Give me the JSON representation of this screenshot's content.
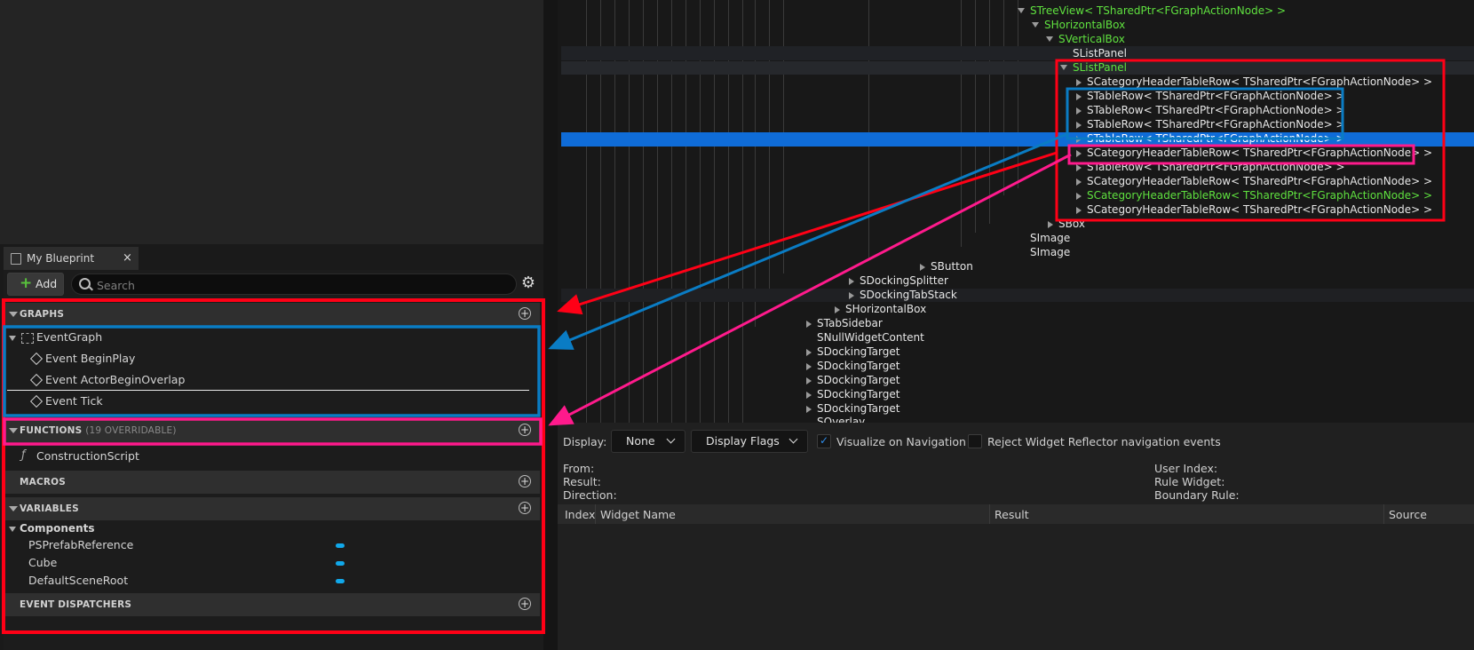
{
  "my_blueprint": {
    "tab_title": "My Blueprint",
    "close_glyph": "×",
    "add_label": "Add",
    "search_placeholder": "Search",
    "icons": {
      "tab": "book-icon",
      "add": "plus-icon",
      "search": "search-icon",
      "settings": "gear-icon"
    },
    "sections": {
      "graphs": "GRAPHS",
      "functions": "FUNCTIONS",
      "functions_sub": "(19 OVERRIDABLE)",
      "macros": "MACROS",
      "variables": "VARIABLES",
      "event_dispatchers": "EVENT DISPATCHERS"
    },
    "graphs": {
      "event_graph": "EventGraph",
      "events": [
        "Event BeginPlay",
        "Event ActorBeginOverlap",
        "Event Tick"
      ]
    },
    "functions": [
      "ConstructionScript"
    ],
    "variables": {
      "category": "Components",
      "items": [
        "PSPrefabReference",
        "Cube",
        "DefaultSceneRoot"
      ]
    }
  },
  "tree": {
    "nodes": [
      {
        "label": "STreeView< TSharedPtr<FGraphActionNode> >",
        "green": true
      },
      {
        "label": "SHorizontalBox",
        "green": true
      },
      {
        "label": "SVerticalBox",
        "green": true
      },
      {
        "label": "SListPanel",
        "green": false
      },
      {
        "label": "SListPanel",
        "green": true
      },
      {
        "label": "SCategoryHeaderTableRow< TSharedPtr<FGraphActionNode> >",
        "green": false
      },
      {
        "label": "STableRow< TSharedPtr<FGraphActionNode> >",
        "green": false
      },
      {
        "label": "STableRow< TSharedPtr<FGraphActionNode> >",
        "green": false
      },
      {
        "label": "STableRow< TSharedPtr<FGraphActionNode> >",
        "green": false
      },
      {
        "label": "STableRow< TSharedPtr<FGraphActionNode> >",
        "green": false
      },
      {
        "label": "SCategoryHeaderTableRow< TSharedPtr<FGraphActionNode> >",
        "green": false
      },
      {
        "label": "STableRow< TSharedPtr<FGraphActionNode> >",
        "green": false
      },
      {
        "label": "SCategoryHeaderTableRow< TSharedPtr<FGraphActionNode> >",
        "green": false
      },
      {
        "label": "SCategoryHeaderTableRow< TSharedPtr<FGraphActionNode> >",
        "green": true
      },
      {
        "label": "SCategoryHeaderTableRow< TSharedPtr<FGraphActionNode> >",
        "green": false
      },
      {
        "label": "SBox",
        "green": false
      },
      {
        "label": "SImage",
        "green": false
      },
      {
        "label": "SImage",
        "green": false
      },
      {
        "label": "SButton",
        "green": false
      },
      {
        "label": "SDockingSplitter",
        "green": false
      },
      {
        "label": "SDockingTabStack",
        "green": false
      },
      {
        "label": "SHorizontalBox",
        "green": false
      },
      {
        "label": "STabSidebar",
        "green": false
      },
      {
        "label": "SNullWidgetContent",
        "green": false
      },
      {
        "label": "SDockingTarget",
        "green": false
      },
      {
        "label": "SDockingTarget",
        "green": false
      },
      {
        "label": "SDockingTarget",
        "green": false
      },
      {
        "label": "SDockingTarget",
        "green": false
      },
      {
        "label": "SDockingTarget",
        "green": false
      },
      {
        "label": "SOverlay",
        "green": false
      }
    ]
  },
  "reflector": {
    "display_label": "Display:",
    "display_value": "None",
    "display_flags_label": "Display Flags",
    "visualize_label": "Visualize on Navigation",
    "visualize_checked": true,
    "reject_label": "Reject Widget Reflector navigation events",
    "reject_checked": false,
    "check_glyph": "✓",
    "info_left": [
      "From:",
      "Result:",
      "Direction:"
    ],
    "info_right": [
      "User Index:",
      "Rule Widget:",
      "Boundary Rule:"
    ],
    "columns": [
      "Index",
      "Widget Name",
      "Result",
      "Source"
    ]
  },
  "colors": {
    "highlight": "#0f6cd8",
    "green_text": "#5fe13f",
    "annotation_red": "#ff0016",
    "annotation_blue": "#0a7cc4",
    "annotation_pink": "#ff1a8c"
  }
}
